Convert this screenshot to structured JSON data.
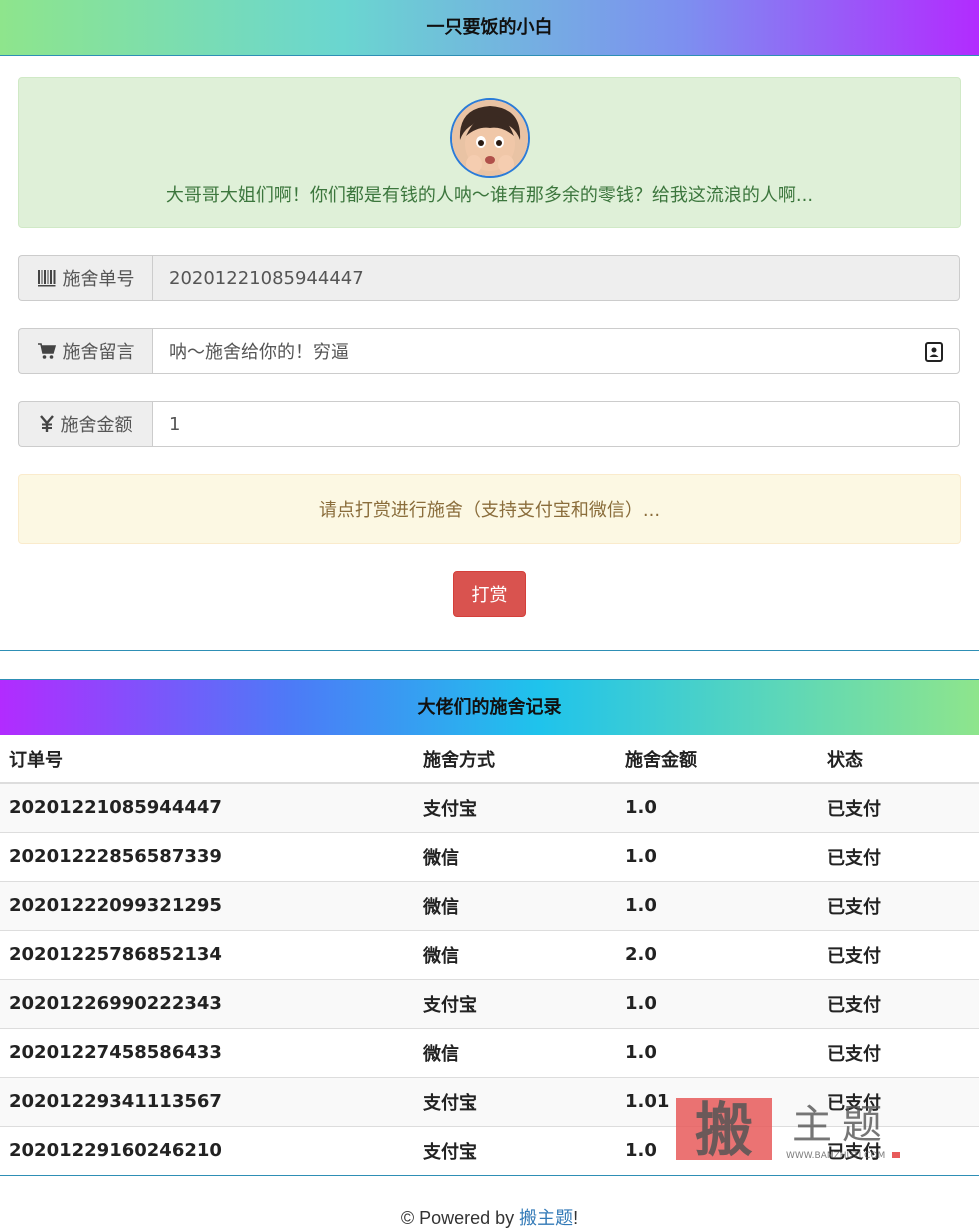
{
  "header": {
    "title": "一只要饭的小白"
  },
  "profile": {
    "avatar_icon": "child-avatar",
    "message": "大哥哥大姐们啊！你们都是有钱的人呐～谁有那多余的零钱？给我这流浪的人啊..."
  },
  "form": {
    "order": {
      "label": "施舍单号",
      "icon": "barcode-icon",
      "value": "20201221085944447"
    },
    "message": {
      "label": "施舍留言",
      "icon": "cart-icon",
      "value": "呐～施舍给你的！穷逼"
    },
    "amount": {
      "label": "施舍金额",
      "icon": "yen-icon",
      "value": "1"
    }
  },
  "notice": "请点打赏进行施舍（支持支付宝和微信）...",
  "tip_button": "打赏",
  "records": {
    "title": "大佬们的施舍记录",
    "columns": [
      "订单号",
      "施舍方式",
      "施舍金额",
      "状态"
    ],
    "rows": [
      [
        "20201221085944447",
        "支付宝",
        "1.0",
        "已支付"
      ],
      [
        "20201222856587339",
        "微信",
        "1.0",
        "已支付"
      ],
      [
        "20201222099321295",
        "微信",
        "1.0",
        "已支付"
      ],
      [
        "20201225786852134",
        "微信",
        "2.0",
        "已支付"
      ],
      [
        "20201226990222343",
        "支付宝",
        "1.0",
        "已支付"
      ],
      [
        "20201227458586433",
        "微信",
        "1.0",
        "已支付"
      ],
      [
        "20201229341113567",
        "支付宝",
        "1.01",
        "已支付"
      ],
      [
        "20201229160246210",
        "支付宝",
        "1.0",
        "已支付"
      ]
    ]
  },
  "footer": {
    "prefix": "© Powered by ",
    "link": "搬主题",
    "suffix": "!"
  },
  "watermark": {
    "char": "搬",
    "text": "主题",
    "url": "WWW.BANZHUTI.COM"
  },
  "colors": {
    "danger": "#d9534f",
    "success_bg": "#dff0d8",
    "warning_bg": "#fcf8e3",
    "link": "#337ab7"
  }
}
